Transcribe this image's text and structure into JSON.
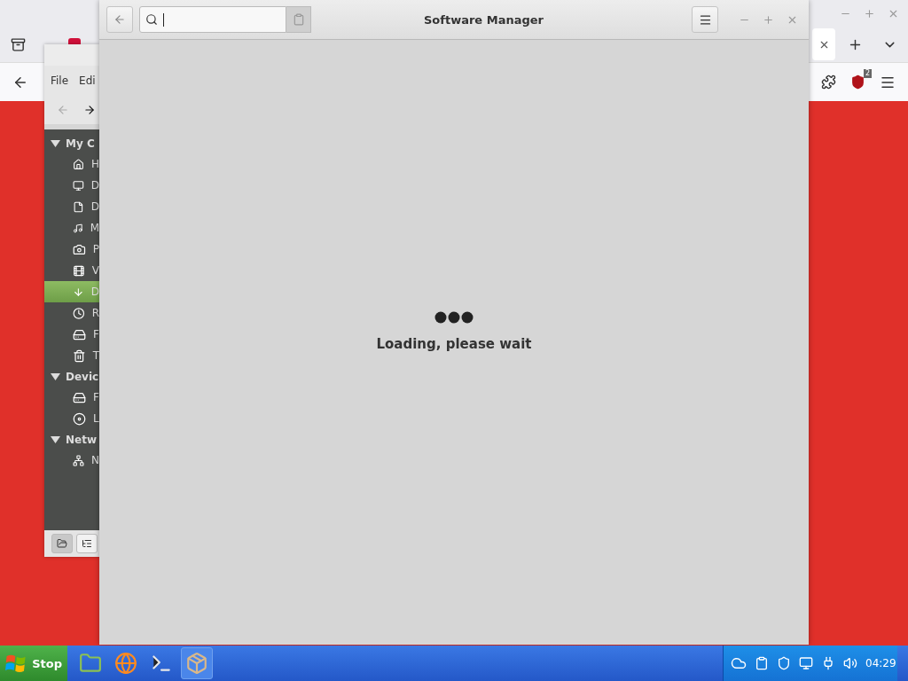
{
  "browser": {
    "addon_badge": "2"
  },
  "file_manager": {
    "menu": [
      "File",
      "Edi"
    ],
    "sections": [
      {
        "title": "My C",
        "expanded": true,
        "items": [
          {
            "label": "H",
            "kind": "home",
            "selected": false
          },
          {
            "label": "D",
            "kind": "desktop",
            "selected": false
          },
          {
            "label": "D",
            "kind": "document",
            "selected": false
          },
          {
            "label": "M",
            "kind": "music",
            "selected": false
          },
          {
            "label": "P",
            "kind": "pictures",
            "selected": false
          },
          {
            "label": "V",
            "kind": "video",
            "selected": false
          },
          {
            "label": "D",
            "kind": "download",
            "selected": true
          },
          {
            "label": "R",
            "kind": "recent",
            "selected": false
          },
          {
            "label": "F",
            "kind": "filesystem",
            "selected": false
          },
          {
            "label": "T",
            "kind": "trash",
            "selected": false
          }
        ]
      },
      {
        "title": "Devic",
        "expanded": true,
        "items": [
          {
            "label": "F",
            "kind": "drive",
            "selected": false
          },
          {
            "label": "L",
            "kind": "disc",
            "selected": false
          }
        ]
      },
      {
        "title": "Netw",
        "expanded": true,
        "items": [
          {
            "label": "N",
            "kind": "network",
            "selected": false
          }
        ]
      }
    ]
  },
  "software_manager": {
    "title": "Software Manager",
    "status": "Loading, please wait"
  },
  "taskbar": {
    "start": "Stop",
    "apps": [
      {
        "kind": "folder",
        "selected": false
      },
      {
        "kind": "browser",
        "selected": false
      },
      {
        "kind": "terminal",
        "selected": false
      },
      {
        "kind": "package",
        "selected": true
      }
    ],
    "clock": "04:29"
  }
}
